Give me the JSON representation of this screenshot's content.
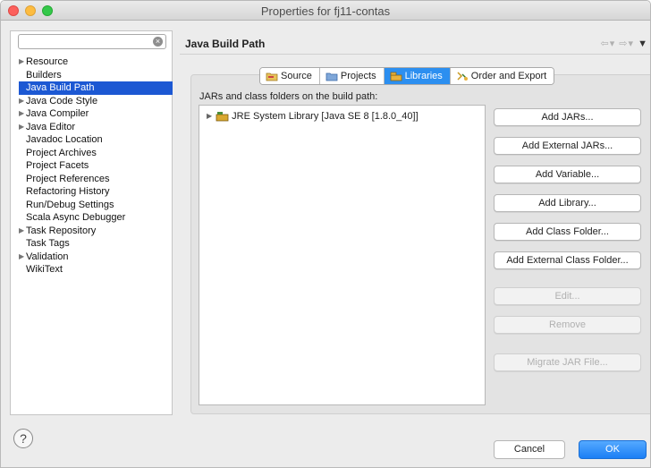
{
  "window": {
    "title": "Properties for fj11-contas"
  },
  "sidebar": {
    "filter_placeholder": "",
    "items": [
      {
        "label": "Resource",
        "expandable": true
      },
      {
        "label": "Builders",
        "expandable": false
      },
      {
        "label": "Java Build Path",
        "expandable": false,
        "selected": true
      },
      {
        "label": "Java Code Style",
        "expandable": true
      },
      {
        "label": "Java Compiler",
        "expandable": true
      },
      {
        "label": "Java Editor",
        "expandable": true
      },
      {
        "label": "Javadoc Location",
        "expandable": false
      },
      {
        "label": "Project Archives",
        "expandable": false
      },
      {
        "label": "Project Facets",
        "expandable": false
      },
      {
        "label": "Project References",
        "expandable": false
      },
      {
        "label": "Refactoring History",
        "expandable": false
      },
      {
        "label": "Run/Debug Settings",
        "expandable": false
      },
      {
        "label": "Scala Async Debugger",
        "expandable": false
      },
      {
        "label": "Task Repository",
        "expandable": true
      },
      {
        "label": "Task Tags",
        "expandable": false
      },
      {
        "label": "Validation",
        "expandable": true
      },
      {
        "label": "WikiText",
        "expandable": false
      }
    ]
  },
  "panel": {
    "title": "Java Build Path",
    "tabs": [
      {
        "label": "Source",
        "icon": "source-folder-icon"
      },
      {
        "label": "Projects",
        "icon": "projects-folder-icon"
      },
      {
        "label": "Libraries",
        "icon": "libraries-icon",
        "active": true
      },
      {
        "label": "Order and Export",
        "icon": "order-export-icon"
      }
    ],
    "section_label": "JARs and class folders on the build path:",
    "entries": [
      {
        "label": "JRE System Library [Java SE 8 [1.8.0_40]]"
      }
    ],
    "buttons": {
      "add_jars": "Add JARs...",
      "add_external_jars": "Add External JARs...",
      "add_variable": "Add Variable...",
      "add_library": "Add Library...",
      "add_class_folder": "Add Class Folder...",
      "add_external_class_folder": "Add External Class Folder...",
      "edit": "Edit...",
      "remove": "Remove",
      "migrate_jar": "Migrate JAR File..."
    }
  },
  "footer": {
    "help": "?",
    "cancel": "Cancel",
    "ok": "OK"
  },
  "colors": {
    "selection": "#1c58d3",
    "active_tab": "#2c8ff0",
    "ok_button": "#1b7ff5"
  }
}
